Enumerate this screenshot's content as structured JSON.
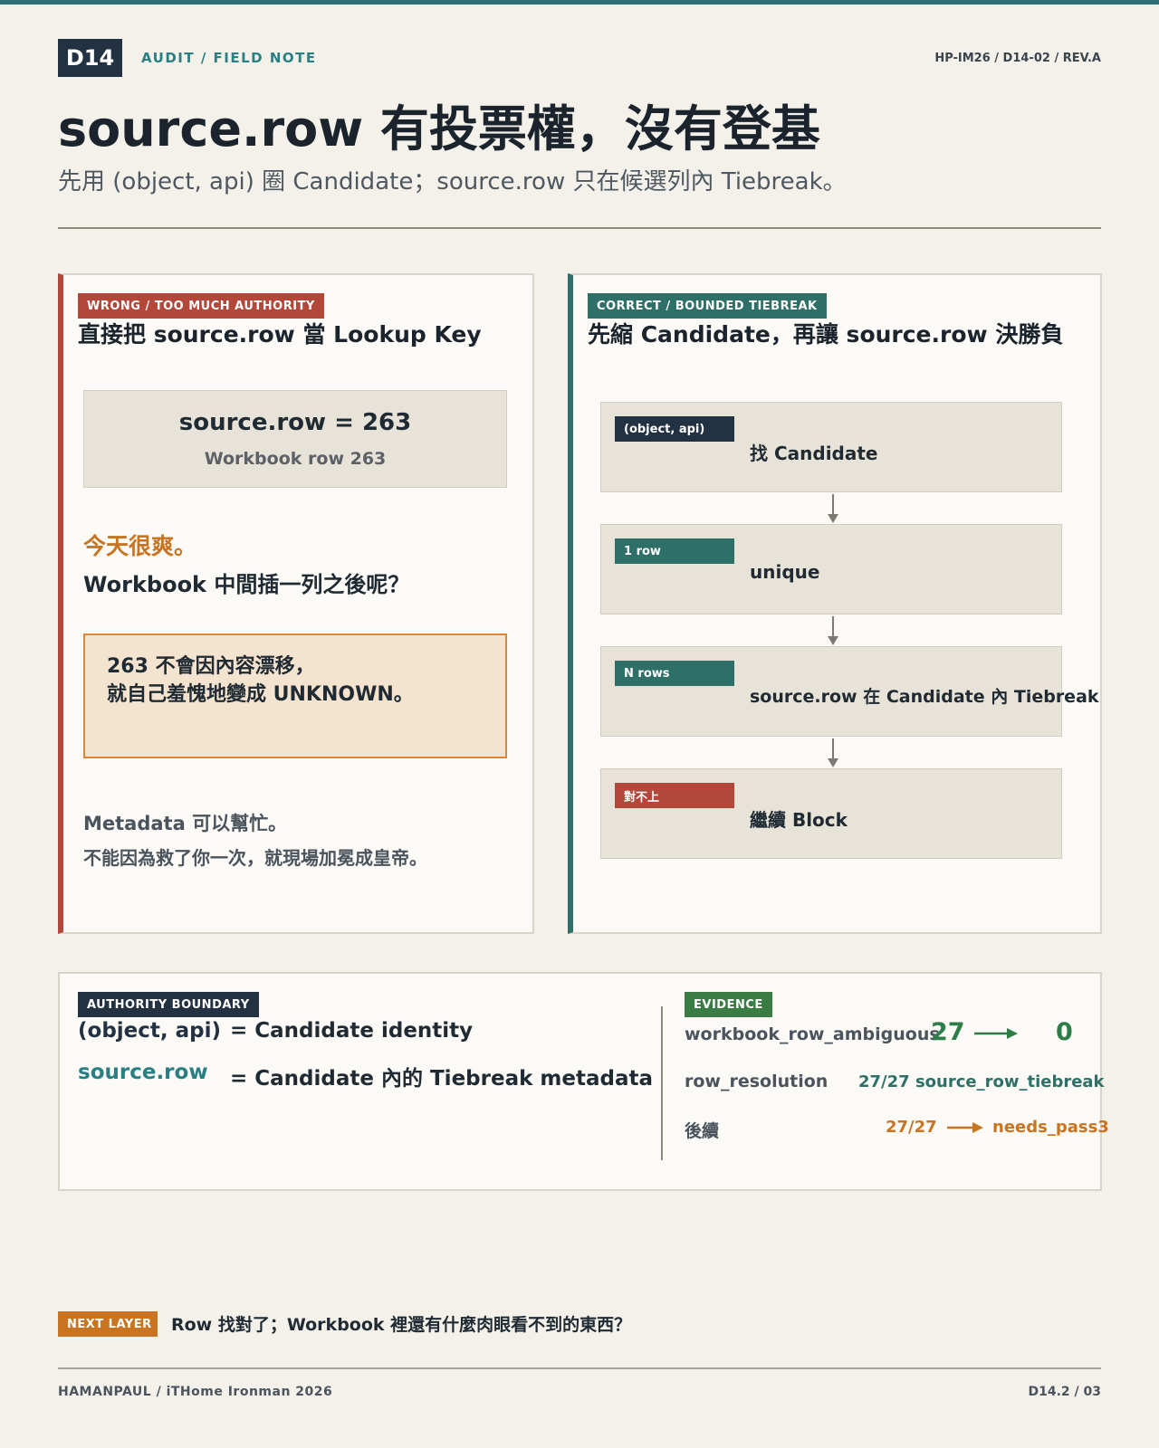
{
  "header": {
    "day": "D14",
    "kicker": "AUDIT / FIELD NOTE",
    "doc_id": "HP-IM26 / D14-02 / REV.A",
    "title": "source.row 有投票權，沒有登基",
    "subtitle": "先用 (object, api) 圈 Candidate；source.row 只在候選列內 Tiebreak。"
  },
  "wrong_panel": {
    "tag": "WRONG / TOO MUCH AUTHORITY",
    "heading": "直接把 source.row 當 Lookup Key",
    "row_value": "source.row = 263",
    "row_sub": "Workbook row 263",
    "good_day": "今天很爽。",
    "question": "Workbook 中間插一列之後呢？",
    "warning_line1": "263 不會因內容漂移，",
    "warning_line2": "就自己羞愧地變成 UNKNOWN。",
    "meta_line1": "Metadata 可以幫忙。",
    "meta_line2": "不能因為救了你一次，就現場加冕成皇帝。"
  },
  "correct_panel": {
    "tag": "CORRECT / BOUNDED TIEBREAK",
    "heading": "先縮 Candidate，再讓 source.row 決勝負",
    "steps": [
      {
        "tag": "(object, api)",
        "text": "找 Candidate",
        "color": "#233242"
      },
      {
        "tag": "1 row",
        "text": "unique",
        "color": "#2e7068"
      },
      {
        "tag": "N rows",
        "text": "source.row 在 Candidate 內 Tiebreak",
        "color": "#2e7068"
      },
      {
        "tag": "對不上",
        "text": "繼續 Block",
        "color": "#b2473a"
      }
    ]
  },
  "authority": {
    "tag": "AUTHORITY BOUNDARY",
    "rows": [
      {
        "key": "(object, api)",
        "value": "= Candidate identity"
      },
      {
        "key": "source.row",
        "value": "= Candidate 內的 Tiebreak metadata"
      }
    ]
  },
  "evidence": {
    "tag": "EVIDENCE",
    "ambiguous_label": "workbook_row_ambiguous",
    "ambiguous_from": "27",
    "ambiguous_to": "0",
    "resolution_label": "row_resolution",
    "resolution_value": "27/27 source_row_tiebreak",
    "followup_label": "後續",
    "followup_from": "27/27",
    "followup_to": "needs_pass3"
  },
  "next_layer": {
    "tag": "NEXT LAYER",
    "text": "Row 找對了；Workbook 裡還有什麼肉眼看不到的東西？"
  },
  "footer": {
    "left": "HAMANPAUL / iTHome Ironman 2026",
    "right": "D14.2 / 03"
  },
  "colors": {
    "accent_teal": "#2d6f73",
    "wrong_red": "#b2473a",
    "correct_green": "#2e7068",
    "navy": "#233242",
    "orange": "#c97420",
    "evidence_green": "#3a7d44"
  }
}
